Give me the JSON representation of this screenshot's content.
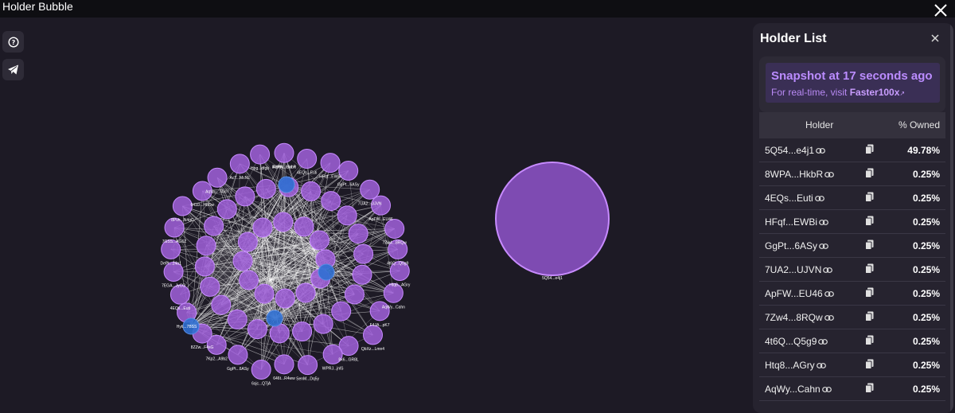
{
  "window": {
    "title": "Holder Bubble"
  },
  "toolbar": {
    "help_icon": "question-circle-icon",
    "telegram_icon": "paper-plane-icon"
  },
  "graph": {
    "colors": {
      "bubble": "#9d5fd6",
      "bubble_stroke": "#c78bff",
      "cluster_node": "#2f6fd1",
      "edge": "#ffffff",
      "big_bubble": "#7e4bb2"
    },
    "big_bubble_label": "5Q54...e4j1",
    "node_labels": [
      "8WPA...HkbR",
      "4EQs...Euti",
      "HFqf...EWBi",
      "GgPt...6ASy",
      "7UA2...UJVN",
      "ApFW...EU46",
      "7Zw4...8RQw",
      "4t6Q...Q5g9",
      "Htq8...AGry",
      "AqWy...Cahn",
      "F4JA...pK7",
      "QbXz...Lmn4",
      "8x6...GR8L",
      "WPRJ...jnlS",
      "SenM...Dq5y",
      "646t...R4ww",
      "6sjc...Q7jA",
      "GgPt...6ASy",
      "7Kp2...A9b2",
      "8ZZw...F4sG",
      "Hyti...7BSS",
      "4EQs...Euti",
      "7EGA...JyCG",
      "DePt...24a1",
      "7GSS...AG6Z",
      "8Pvh...N4gC",
      "641D...HbDw",
      "AqWu...SbdY",
      "AcT...McNL",
      "Hpg...dfgb",
      "AqWy...Cahn"
    ]
  },
  "panel": {
    "title": "Holder List",
    "snapshot_title": "Snapshot at 17 seconds ago",
    "snapshot_prefix": "For real-time, visit",
    "snapshot_link": "Faster100x",
    "col_holder": "Holder",
    "col_owned": "% Owned",
    "rows": [
      {
        "address": "5Q54...e4j1",
        "owned": "49.78%"
      },
      {
        "address": "8WPA...HkbR",
        "owned": "0.25%"
      },
      {
        "address": "4EQs...Euti",
        "owned": "0.25%"
      },
      {
        "address": "HFqf...EWBi",
        "owned": "0.25%"
      },
      {
        "address": "GgPt...6ASy",
        "owned": "0.25%"
      },
      {
        "address": "7UA2...UJVN",
        "owned": "0.25%"
      },
      {
        "address": "ApFW...EU46",
        "owned": "0.25%"
      },
      {
        "address": "7Zw4...8RQw",
        "owned": "0.25%"
      },
      {
        "address": "4t6Q...Q5g9",
        "owned": "0.25%"
      },
      {
        "address": "Htq8...AGry",
        "owned": "0.25%"
      },
      {
        "address": "AqWy...Cahn",
        "owned": "0.25%"
      }
    ]
  }
}
